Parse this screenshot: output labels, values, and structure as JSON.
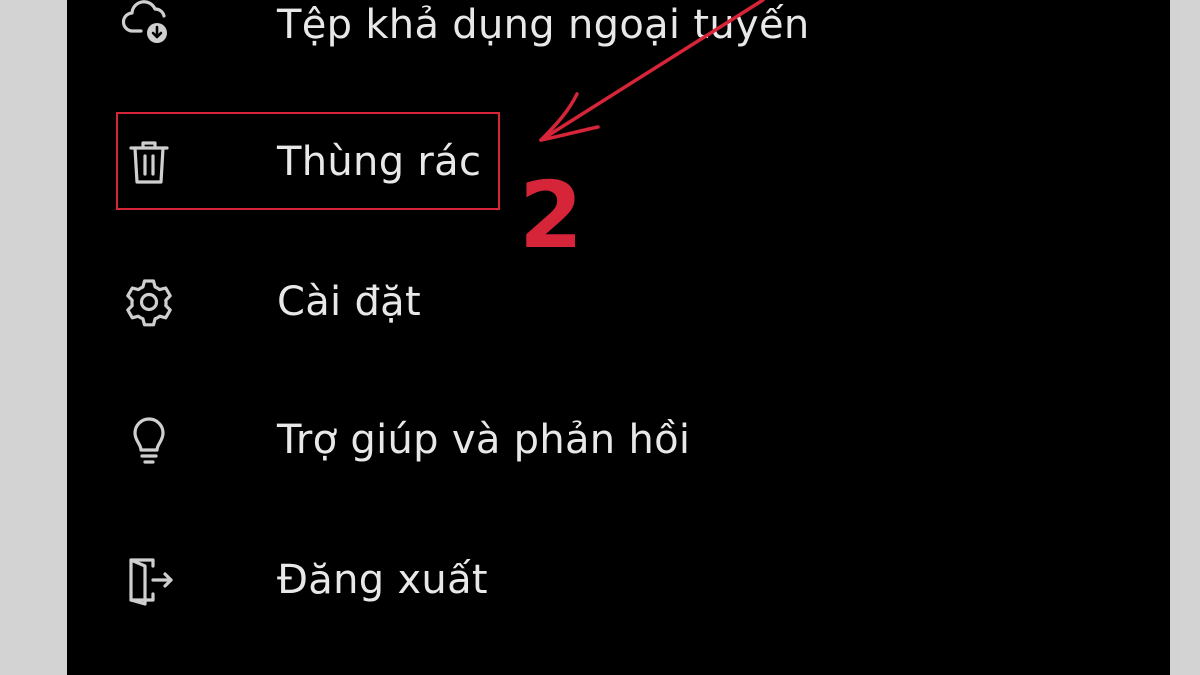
{
  "menu": {
    "items": [
      {
        "label": "Tệp khả dụng ngoại tuyến",
        "icon": "cloud-download-icon"
      },
      {
        "label": "Thùng rác",
        "icon": "trash-icon"
      },
      {
        "label": "Cài đặt",
        "icon": "gear-icon"
      },
      {
        "label": "Trợ giúp và phản hồi",
        "icon": "lightbulb-icon"
      },
      {
        "label": "Đăng xuất",
        "icon": "sign-out-icon"
      }
    ]
  },
  "annotation": {
    "step_number": "2",
    "color": "#d62438"
  },
  "colors": {
    "background": "#000000",
    "frame": "#d3d3d3",
    "text": "#e8e8e8",
    "icon": "#cfcfcf"
  }
}
